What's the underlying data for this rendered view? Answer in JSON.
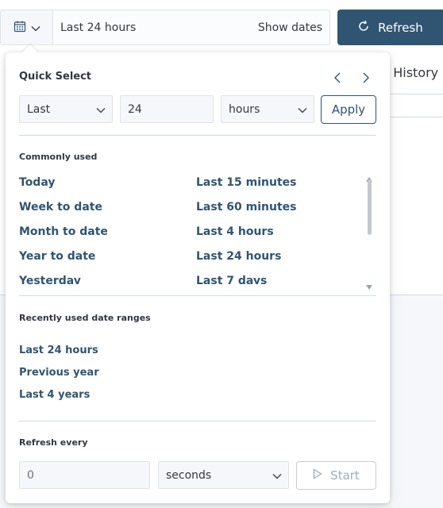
{
  "background": {
    "tab_partial": "n History"
  },
  "date_bar": {
    "value": "Last 24 hours",
    "show_dates_label": "Show dates"
  },
  "refresh_button": {
    "label": "Refresh",
    "color": "#2f5573"
  },
  "quick_select": {
    "title": "Quick Select",
    "tense": "Last",
    "value": "24",
    "unit": "hours",
    "apply_label": "Apply"
  },
  "commonly_used": {
    "title": "Commonly used",
    "left": [
      "Today",
      "Week to date",
      "Month to date",
      "Year to date",
      "Yesterday"
    ],
    "right": [
      "Last 15 minutes",
      "Last 60 minutes",
      "Last 4 hours",
      "Last 24 hours",
      "Last 7 days"
    ]
  },
  "recently_used": {
    "title": "Recently used date ranges",
    "items": [
      "Last 24 hours",
      "Previous year",
      "Last 4 years"
    ]
  },
  "refresh_every": {
    "title": "Refresh every",
    "value": "0",
    "unit": "seconds",
    "start_label": "Start"
  },
  "colors": {
    "link": "#2f5573",
    "border": "#d3dae6",
    "field_bg": "#f5f7fa"
  },
  "icons": {
    "calendar": "calendar-icon",
    "refresh": "refresh-icon",
    "play": "play-icon"
  }
}
